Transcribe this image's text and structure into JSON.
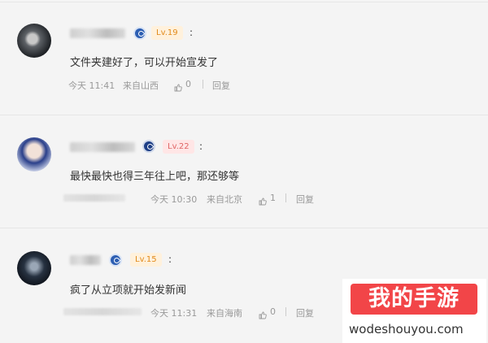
{
  "comments": [
    {
      "level": "Lv.19",
      "colon": ":",
      "text": "文件夹建好了，可以开始宣发了",
      "time": "今天 11:41",
      "location": "来自山西",
      "likes": "0",
      "reply": "回复"
    },
    {
      "level": "Lv.22",
      "colon": ":",
      "text": "最快最快也得三年往上吧，那还够等",
      "time": "今天 10:30",
      "location": "来自北京",
      "likes": "1",
      "reply": "回复"
    },
    {
      "level": "Lv.15",
      "colon": ":",
      "text": "疯了从立项就开始发新闻",
      "time": "今天 11:31",
      "location": "来自海南",
      "likes": "0",
      "reply": "回复"
    }
  ],
  "watermark": {
    "title": "我的手游",
    "url": "wodeshouyou.com"
  }
}
